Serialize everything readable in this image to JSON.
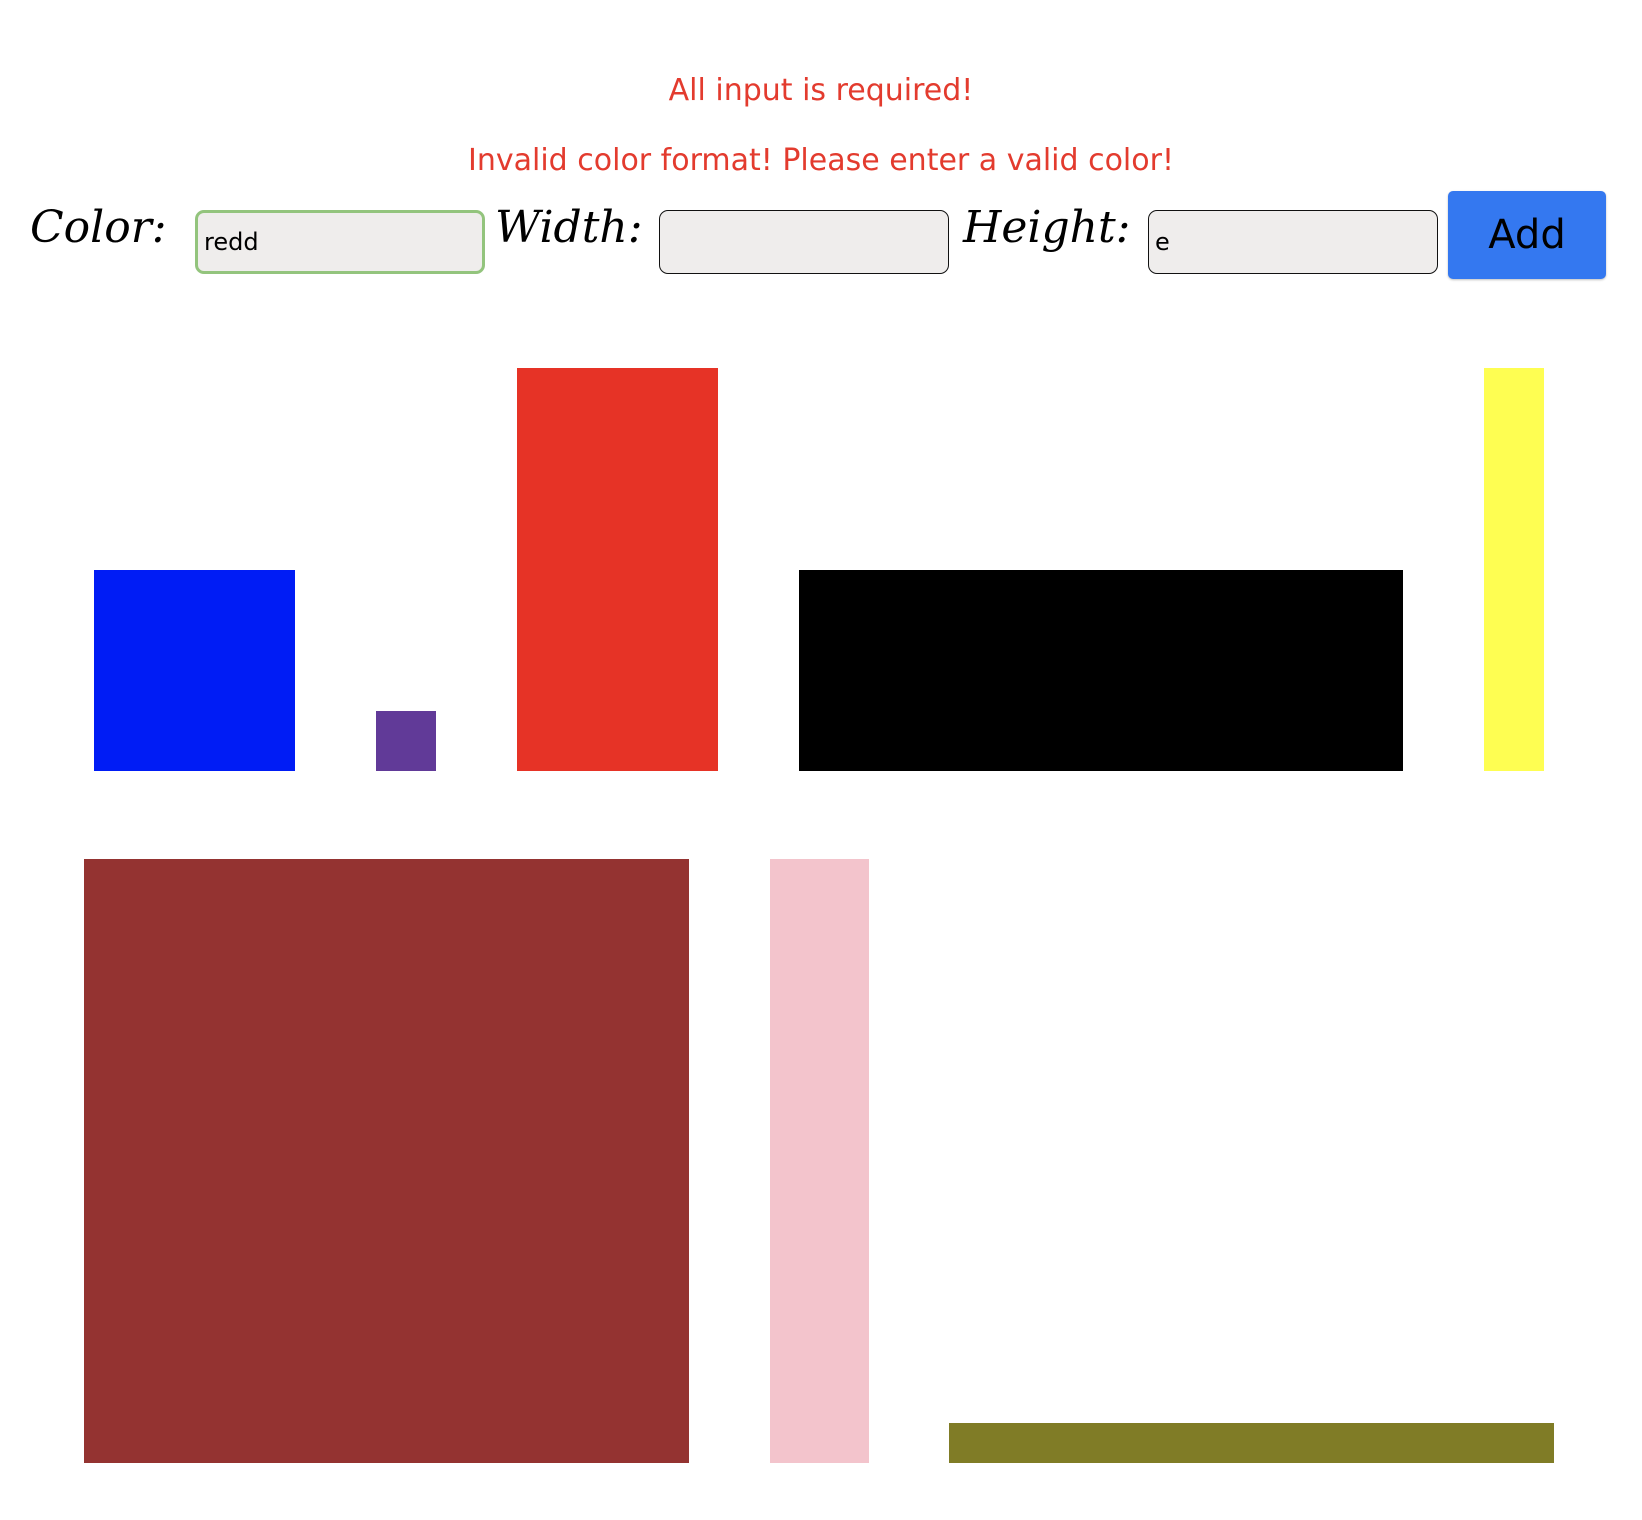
{
  "errors": {
    "required": "All input is required!",
    "invalid_color": "Invalid color format! Please enter a valid color!"
  },
  "form": {
    "color_label": "Color:",
    "color_value": "redd",
    "width_label": "Width:",
    "width_value": "",
    "height_label": "Height:",
    "height_value": "e",
    "add_label": "Add",
    "focus_color": "#93c47d",
    "button_color": "#3478f0"
  },
  "shapes": [
    {
      "name": "blue-rectangle",
      "color": "#001cf5"
    },
    {
      "name": "purple-rectangle",
      "color": "#613a98"
    },
    {
      "name": "red-rectangle",
      "color": "#e63326"
    },
    {
      "name": "black-rectangle",
      "color": "#000000"
    },
    {
      "name": "yellow-rectangle",
      "color": "#fefe52"
    },
    {
      "name": "brown-rectangle",
      "color": "#943331"
    },
    {
      "name": "pink-rectangle",
      "color": "#f3c4cc"
    },
    {
      "name": "olive-rectangle",
      "color": "#807c26"
    }
  ]
}
